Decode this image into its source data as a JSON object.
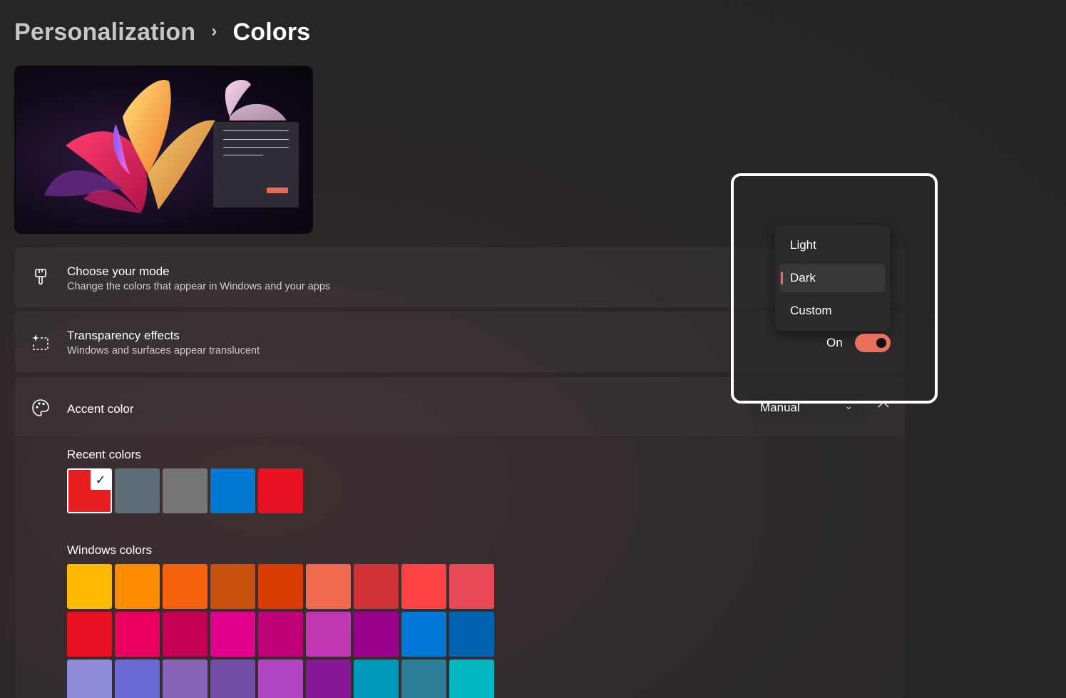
{
  "breadcrumb": {
    "parent": "Personalization",
    "separator": "›",
    "current": "Colors"
  },
  "mode_card": {
    "title": "Choose your mode",
    "subtitle": "Change the colors that appear in Windows and your apps",
    "icon": "paintbrush-icon"
  },
  "transparency_card": {
    "title": "Transparency effects",
    "subtitle": "Windows and surfaces appear translucent",
    "icon": "transparency-icon",
    "toggle_label": "On",
    "toggle_on": true
  },
  "accent_card": {
    "title": "Accent color",
    "icon": "palette-icon",
    "dropdown_value": "Manual",
    "recent_label": "Recent colors",
    "windows_label": "Windows colors",
    "recent_colors": [
      "#e81e1e",
      "#5d6b77",
      "#767676",
      "#0078d4",
      "#e81123"
    ],
    "selected_recent_index": 0,
    "windows_colors": [
      [
        "#ffb900",
        "#ff8c00",
        "#f7630c",
        "#ca5010",
        "#da3b01",
        "#ef6950",
        "#d13438",
        "#ff4343",
        "#e74856"
      ],
      [
        "#e81123",
        "#ea005e",
        "#c30052",
        "#e3008c",
        "#bf0077",
        "#c239b3",
        "#9a0089",
        "#0078d7",
        "#0063b1"
      ],
      [
        "#8e8cd8",
        "#6b69d6",
        "#8764b8",
        "#744da9",
        "#b146c2",
        "#881798",
        "#0099bc",
        "#2d7d9a",
        "#00b7c3"
      ]
    ]
  },
  "mode_menu": {
    "options": [
      "Light",
      "Dark",
      "Custom"
    ],
    "selected": "Dark"
  },
  "colors": {
    "accent": "#e8705e",
    "highlight_border": "#ffffff"
  }
}
